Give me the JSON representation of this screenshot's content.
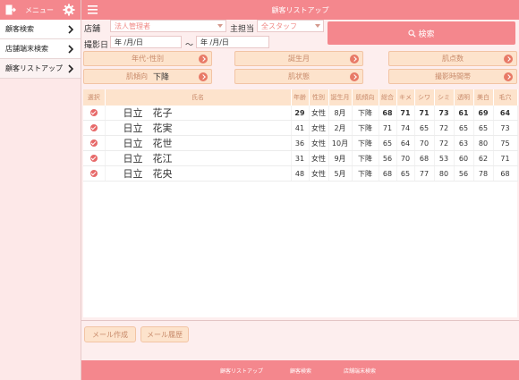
{
  "sidebar": {
    "menu_label": "メニュー",
    "items": [
      {
        "label": "顧客検索"
      },
      {
        "label": "店舗端末検索"
      },
      {
        "label": "顧客リストアップ"
      }
    ]
  },
  "topbar": {
    "title": "顧客リストアップ"
  },
  "form": {
    "store_label": "店舗",
    "store_value": "法人管理者",
    "staff_label": "主担当",
    "staff_value": "全スタッフ",
    "date_label": "撮影日",
    "date_from": "年 /月/日",
    "date_sep": "～",
    "date_to": "年 /月/日",
    "search_label": "検索"
  },
  "filters": {
    "age_gender": "年代･性別",
    "birth_month": "誕生月",
    "skin_score": "肌点数",
    "skin_trend": "肌傾向",
    "skin_trend_value": "下降",
    "skin_state": "肌状態",
    "shoot_time": "撮影時間帯"
  },
  "table": {
    "headers": [
      "選択",
      "氏名",
      "年齢",
      "性別",
      "誕生月",
      "肌傾向",
      "総合",
      "キメ",
      "シワ",
      "シミ",
      "透明",
      "美白",
      "毛穴"
    ],
    "rows": [
      {
        "name": "日立　花子",
        "age": "29",
        "gender": "女性",
        "month": "8月",
        "trend": "下降",
        "total": "68",
        "kime": "71",
        "shiwa": "71",
        "shimi": "73",
        "toumei": "61",
        "bihaku": "69",
        "keana": "64"
      },
      {
        "name": "日立　花実",
        "age": "41",
        "gender": "女性",
        "month": "2月",
        "trend": "下降",
        "total": "71",
        "kime": "74",
        "shiwa": "65",
        "shimi": "72",
        "toumei": "65",
        "bihaku": "65",
        "keana": "73"
      },
      {
        "name": "日立　花世",
        "age": "36",
        "gender": "女性",
        "month": "10月",
        "trend": "下降",
        "total": "65",
        "kime": "64",
        "shiwa": "70",
        "shimi": "72",
        "toumei": "63",
        "bihaku": "80",
        "keana": "75"
      },
      {
        "name": "日立　花江",
        "age": "31",
        "gender": "女性",
        "month": "9月",
        "trend": "下降",
        "total": "56",
        "kime": "70",
        "shiwa": "68",
        "shimi": "53",
        "toumei": "60",
        "bihaku": "62",
        "keana": "71"
      },
      {
        "name": "日立　花央",
        "age": "48",
        "gender": "女性",
        "month": "5月",
        "trend": "下降",
        "total": "68",
        "kime": "65",
        "shiwa": "77",
        "shimi": "80",
        "toumei": "56",
        "bihaku": "78",
        "keana": "68"
      }
    ]
  },
  "actions": {
    "mail_compose": "メール作成",
    "mail_history": "メール履歴"
  },
  "footer": {
    "links": [
      "顧客リストアップ",
      "顧客検索",
      "店舗端末検索"
    ]
  },
  "colors": {
    "accent": "#f4878d",
    "button_bg": "#fde3cc",
    "check": "#e76a6a"
  }
}
